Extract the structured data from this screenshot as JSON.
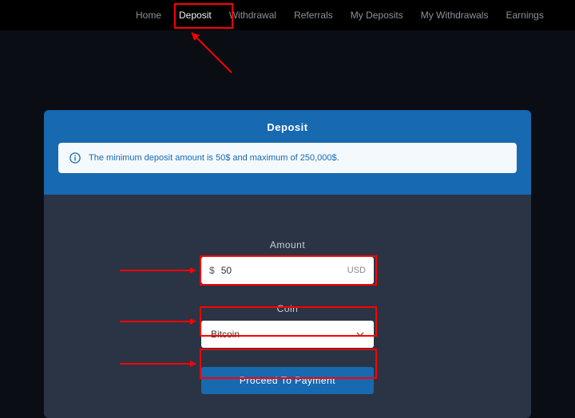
{
  "nav": {
    "items": [
      {
        "label": "Home"
      },
      {
        "label": "Deposit",
        "active": true
      },
      {
        "label": "Withdrawal"
      },
      {
        "label": "Referrals"
      },
      {
        "label": "My Deposits"
      },
      {
        "label": "My Withdrawals"
      },
      {
        "label": "Earnings"
      }
    ]
  },
  "card": {
    "title": "Deposit",
    "notice": "The minimum deposit amount is 50$ and maximum of 250,000$."
  },
  "form": {
    "amount_label": "Amount",
    "amount_prefix": "$",
    "amount_value": "50",
    "amount_suffix": "USD",
    "coin_label": "Coin",
    "coin_value": "Bitcoin",
    "submit_label": "Proceed To Payment"
  },
  "annotation_color": "#ff0000"
}
